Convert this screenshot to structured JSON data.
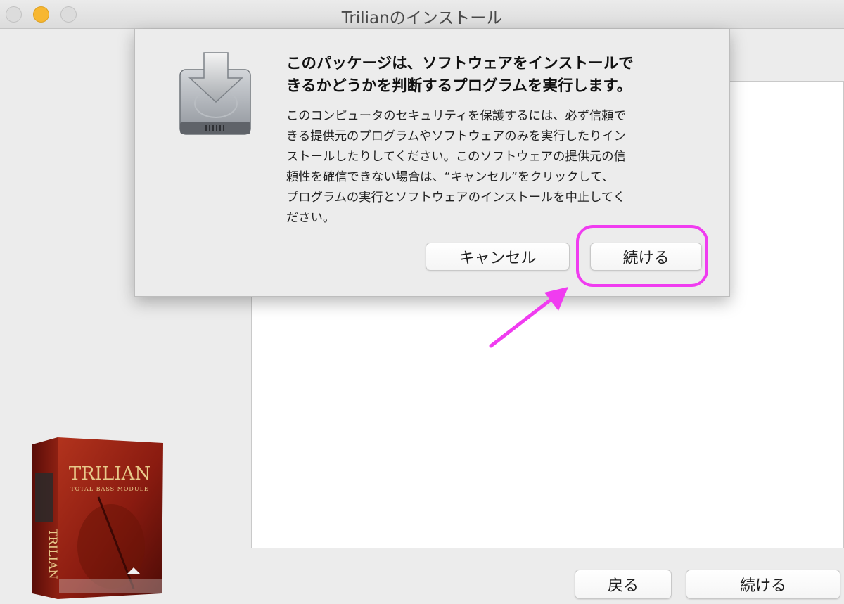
{
  "window": {
    "title": "Trilianのインストール",
    "controls": [
      "close",
      "minimize",
      "zoom"
    ]
  },
  "installer": {
    "back_label": "戻る",
    "continue_label": "続ける",
    "product_box": {
      "title": "TRILIAN",
      "subtitle": "TOTAL BASS MODULE",
      "spine_text": "TRILIAN",
      "colors": {
        "box": "#8a1b10",
        "lettering": "#e8c98a"
      }
    }
  },
  "alert": {
    "icon": "installer-package-disk-icon",
    "heading_lines": [
      "このパッケージは、ソフトウェアをインストールで",
      "きるかどうかを判断するプログラムを実行します。"
    ],
    "message_lines": [
      "このコンピュータのセキュリティを保護するには、必ず信頼で",
      "きる提供元のプログラムやソフトウェアのみを実行したりイン",
      "ストールしたりしてください。このソフトウェアの提供元の信",
      "頼性を確信できない場合は、“キャンセル”をクリックして、",
      "プログラムの実行とソフトウェアのインストールを中止してく",
      "ださい。"
    ],
    "cancel_label": "キャンセル",
    "continue_label": "続ける"
  },
  "annotation": {
    "highlight_color": "#f03cf0",
    "target": "alert-continue-button"
  }
}
